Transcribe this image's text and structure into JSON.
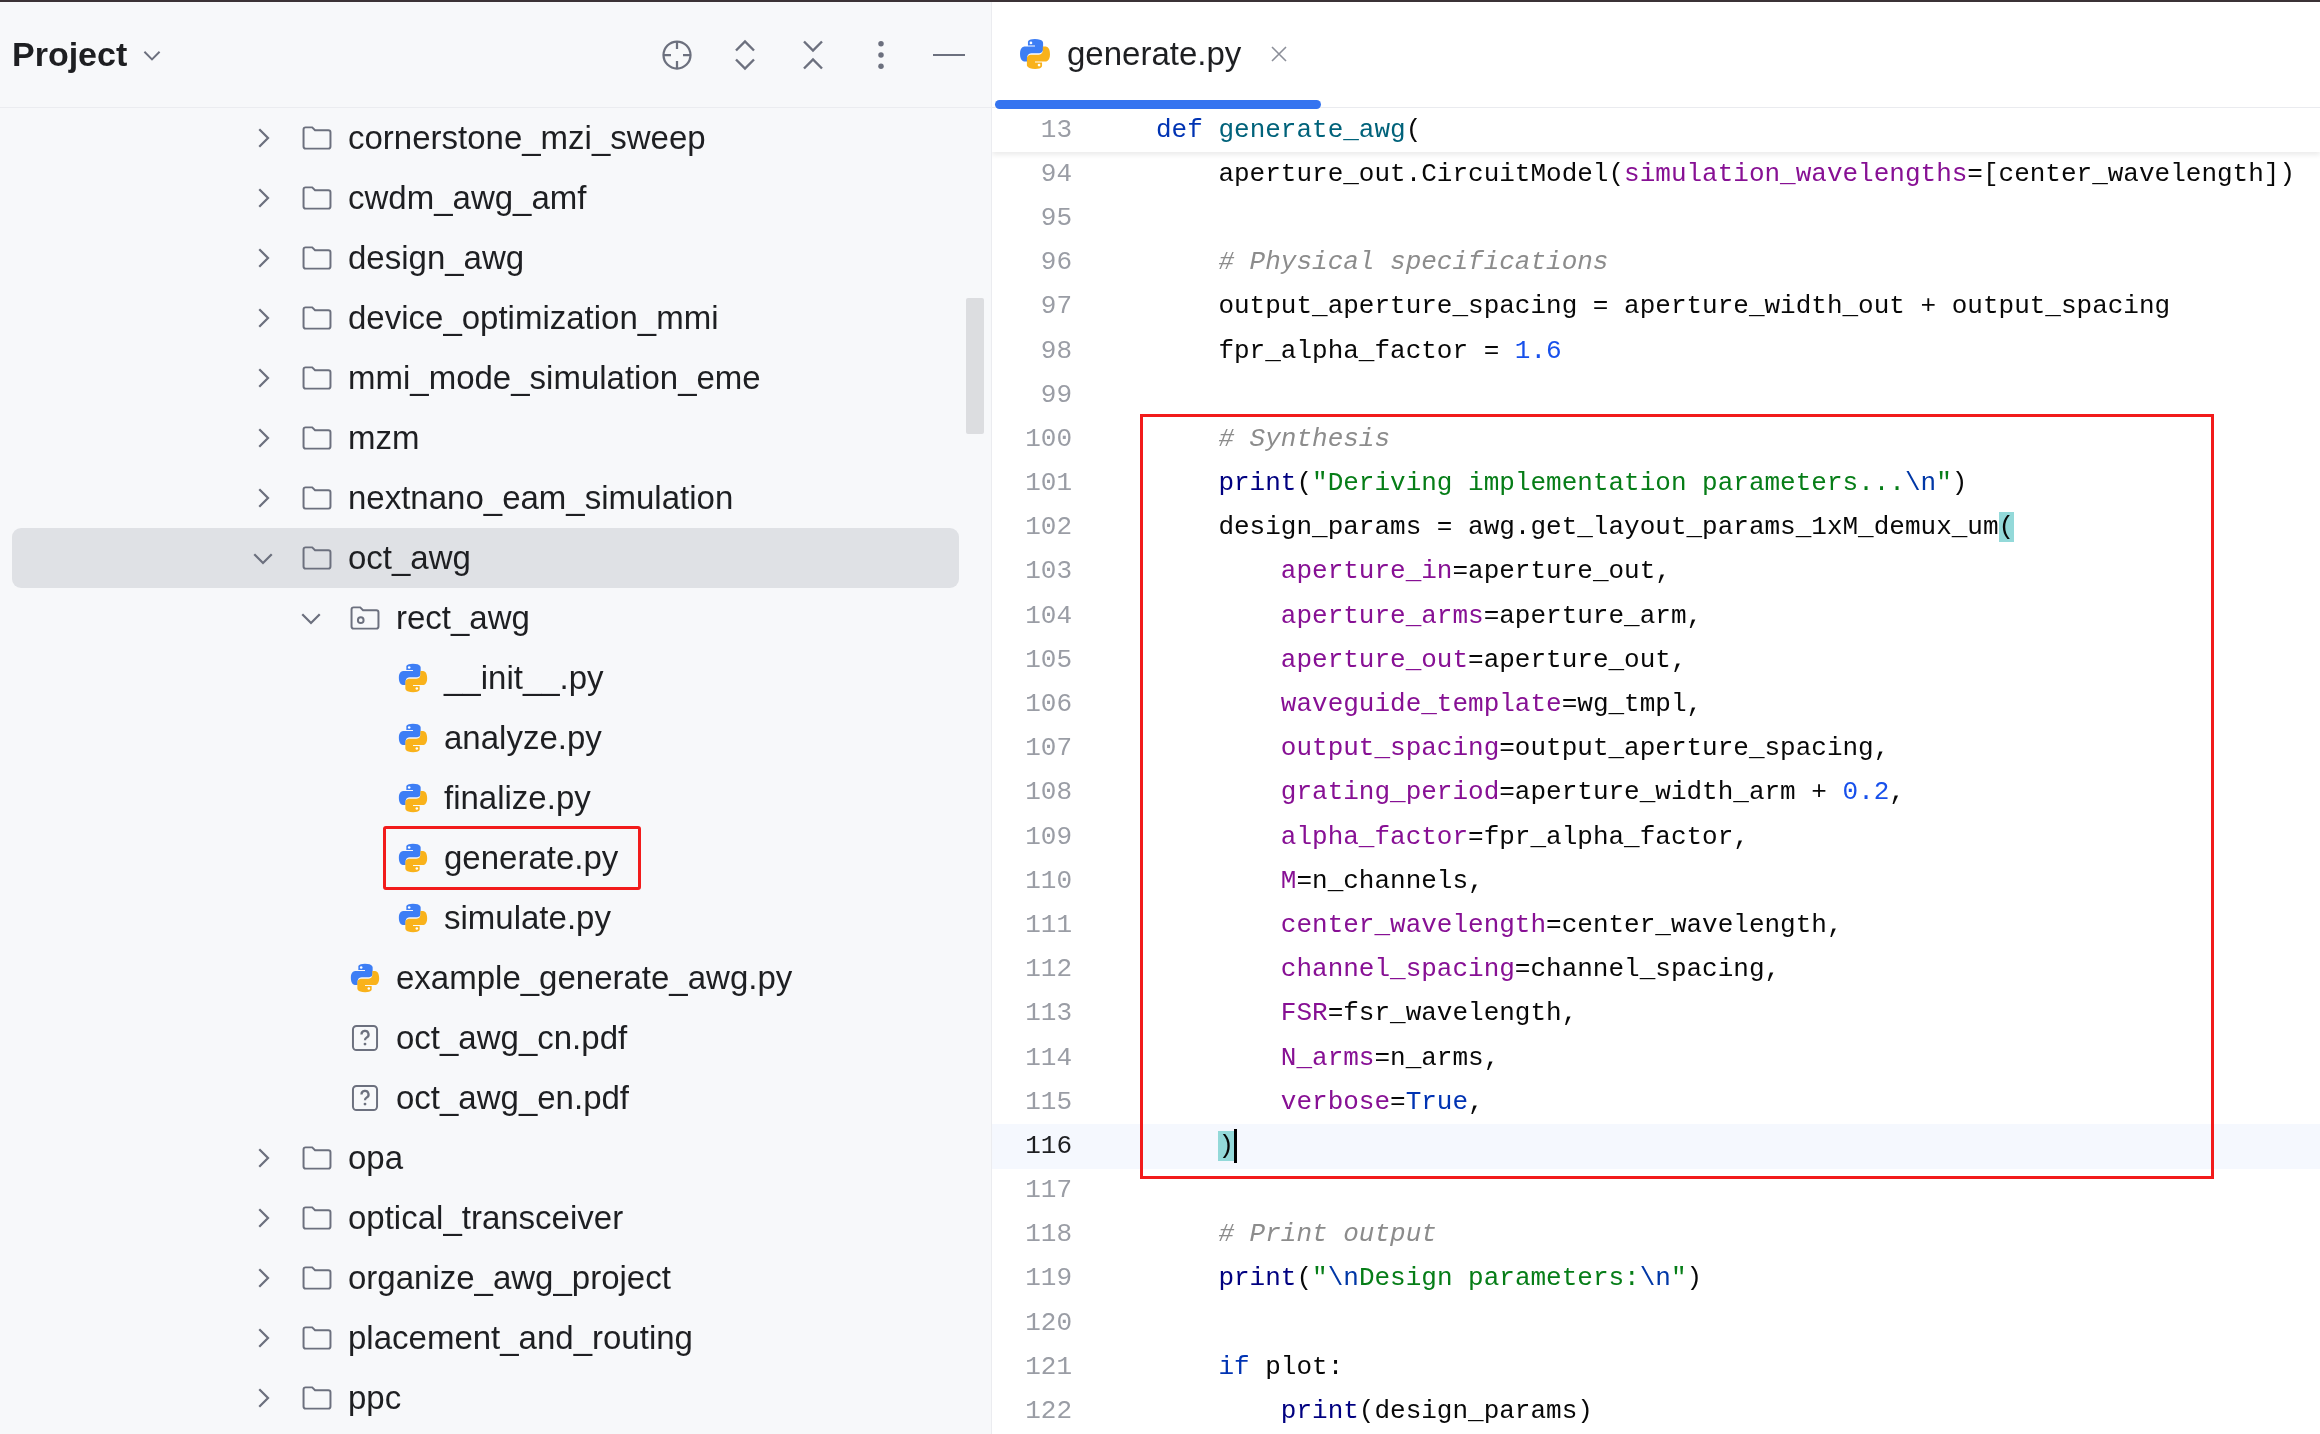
{
  "project_panel": {
    "title": "Project",
    "tree": [
      {
        "label": "cornerstone_mzi_sweep",
        "kind": "folder",
        "expanded": false,
        "selected": false,
        "highlighted": false
      },
      {
        "label": "cwdm_awg_amf",
        "kind": "folder",
        "expanded": false,
        "selected": false,
        "highlighted": false
      },
      {
        "label": "design_awg",
        "kind": "folder",
        "expanded": false,
        "selected": false,
        "highlighted": false
      },
      {
        "label": "device_optimization_mmi",
        "kind": "folder",
        "expanded": false,
        "selected": false,
        "highlighted": false
      },
      {
        "label": "mmi_mode_simulation_eme",
        "kind": "folder",
        "expanded": false,
        "selected": false,
        "highlighted": false
      },
      {
        "label": "mzm",
        "kind": "folder",
        "expanded": false,
        "selected": false,
        "highlighted": false
      },
      {
        "label": "nextnano_eam_simulation",
        "kind": "folder",
        "expanded": false,
        "selected": false,
        "highlighted": false
      },
      {
        "label": "oct_awg",
        "kind": "folder",
        "expanded": true,
        "selected": true,
        "highlighted": false,
        "children": [
          {
            "label": "rect_awg",
            "kind": "package",
            "expanded": true,
            "selected": false,
            "highlighted": false,
            "children": [
              {
                "label": "__init__.py",
                "kind": "python",
                "selected": false,
                "highlighted": false
              },
              {
                "label": "analyze.py",
                "kind": "python",
                "selected": false,
                "highlighted": false
              },
              {
                "label": "finalize.py",
                "kind": "python",
                "selected": false,
                "highlighted": false
              },
              {
                "label": "generate.py",
                "kind": "python",
                "selected": false,
                "highlighted": true
              },
              {
                "label": "simulate.py",
                "kind": "python",
                "selected": false,
                "highlighted": false
              }
            ]
          },
          {
            "label": "example_generate_awg.py",
            "kind": "python",
            "selected": false,
            "highlighted": false
          },
          {
            "label": "oct_awg_cn.pdf",
            "kind": "unknown",
            "selected": false,
            "highlighted": false
          },
          {
            "label": "oct_awg_en.pdf",
            "kind": "unknown",
            "selected": false,
            "highlighted": false
          }
        ]
      },
      {
        "label": "opa",
        "kind": "folder",
        "expanded": false,
        "selected": false,
        "highlighted": false
      },
      {
        "label": "optical_transceiver",
        "kind": "folder",
        "expanded": false,
        "selected": false,
        "highlighted": false
      },
      {
        "label": "organize_awg_project",
        "kind": "folder",
        "expanded": false,
        "selected": false,
        "highlighted": false
      },
      {
        "label": "placement_and_routing",
        "kind": "folder",
        "expanded": false,
        "selected": false,
        "highlighted": false
      },
      {
        "label": "ppc",
        "kind": "folder",
        "expanded": false,
        "selected": false,
        "highlighted": false
      }
    ]
  },
  "editor": {
    "tabs": [
      {
        "label": "generate.py",
        "selected": true
      }
    ],
    "sticky_line": {
      "number": "13",
      "tokens": [
        {
          "text": "def ",
          "kind": "kw"
        },
        {
          "text": "generate_awg",
          "kind": "fn"
        },
        {
          "text": "(",
          "kind": "plain"
        }
      ]
    },
    "blocks": [
      {
        "boxed": false,
        "lines": [
          {
            "number": "94",
            "current": false,
            "tokens": [
              {
                "text": "    aperture_out.CircuitModel(",
                "kind": "plain"
              },
              {
                "text": "simulation_wavelengths",
                "kind": "param"
              },
              {
                "text": "=[center_wavelength])",
                "kind": "plain"
              }
            ]
          },
          {
            "number": "95",
            "current": false
          },
          {
            "number": "96",
            "current": false,
            "tokens": [
              {
                "text": "    # Physical specifications",
                "kind": "comment"
              }
            ]
          },
          {
            "number": "97",
            "current": false,
            "tokens": [
              {
                "text": "    output_aperture_spacing = aperture_width_out + output_spacing",
                "kind": "plain"
              }
            ]
          },
          {
            "number": "98",
            "current": false,
            "tokens": [
              {
                "text": "    fpr_alpha_factor = ",
                "kind": "plain"
              },
              {
                "text": "1.6",
                "kind": "num"
              }
            ]
          },
          {
            "number": "99",
            "current": false
          }
        ]
      },
      {
        "boxed": true,
        "lines": [
          {
            "number": "100",
            "current": false,
            "tokens": [
              {
                "text": "    # Synthesis",
                "kind": "comment"
              }
            ]
          },
          {
            "number": "101",
            "current": false,
            "tokens": [
              {
                "text": "    print",
                "kind": "builtin"
              },
              {
                "text": "(",
                "kind": "plain"
              },
              {
                "text": "\"Deriving implementation parameters...",
                "kind": "str"
              },
              {
                "text": "\\n",
                "kind": "esc"
              },
              {
                "text": "\"",
                "kind": "str"
              },
              {
                "text": ")",
                "kind": "plain"
              }
            ]
          },
          {
            "number": "102",
            "current": false,
            "tokens": [
              {
                "text": "    design_params = awg.get_layout_params_1xM_demux_um",
                "kind": "plain"
              },
              {
                "text": "(",
                "kind": "match"
              }
            ]
          },
          {
            "number": "103",
            "current": false,
            "tokens": [
              {
                "text": "        aperture_in",
                "kind": "param"
              },
              {
                "text": "=aperture_out,",
                "kind": "plain"
              }
            ]
          },
          {
            "number": "104",
            "current": false,
            "tokens": [
              {
                "text": "        aperture_arms",
                "kind": "param"
              },
              {
                "text": "=aperture_arm,",
                "kind": "plain"
              }
            ]
          },
          {
            "number": "105",
            "current": false,
            "tokens": [
              {
                "text": "        aperture_out",
                "kind": "param"
              },
              {
                "text": "=aperture_out,",
                "kind": "plain"
              }
            ]
          },
          {
            "number": "106",
            "current": false,
            "tokens": [
              {
                "text": "        waveguide_template",
                "kind": "param"
              },
              {
                "text": "=wg_tmpl,",
                "kind": "plain"
              }
            ]
          },
          {
            "number": "107",
            "current": false,
            "tokens": [
              {
                "text": "        output_spacing",
                "kind": "param"
              },
              {
                "text": "=output_aperture_spacing,",
                "kind": "plain"
              }
            ]
          },
          {
            "number": "108",
            "current": false,
            "tokens": [
              {
                "text": "        grating_period",
                "kind": "param"
              },
              {
                "text": "=aperture_width_arm + ",
                "kind": "plain"
              },
              {
                "text": "0.2",
                "kind": "num"
              },
              {
                "text": ",",
                "kind": "plain"
              }
            ]
          },
          {
            "number": "109",
            "current": false,
            "tokens": [
              {
                "text": "        alpha_factor",
                "kind": "param"
              },
              {
                "text": "=fpr_alpha_factor,",
                "kind": "plain"
              }
            ]
          },
          {
            "number": "110",
            "current": false,
            "tokens": [
              {
                "text": "        M",
                "kind": "param"
              },
              {
                "text": "=n_channels,",
                "kind": "plain"
              }
            ]
          },
          {
            "number": "111",
            "current": false,
            "tokens": [
              {
                "text": "        center_wavelength",
                "kind": "param"
              },
              {
                "text": "=center_wavelength,",
                "kind": "plain"
              }
            ]
          },
          {
            "number": "112",
            "current": false,
            "tokens": [
              {
                "text": "        channel_spacing",
                "kind": "param"
              },
              {
                "text": "=channel_spacing,",
                "kind": "plain"
              }
            ]
          },
          {
            "number": "113",
            "current": false,
            "tokens": [
              {
                "text": "        FSR",
                "kind": "param"
              },
              {
                "text": "=fsr_wavelength,",
                "kind": "plain"
              }
            ]
          },
          {
            "number": "114",
            "current": false,
            "tokens": [
              {
                "text": "        N_arms",
                "kind": "param"
              },
              {
                "text": "=n_arms,",
                "kind": "plain"
              }
            ]
          },
          {
            "number": "115",
            "current": false,
            "tokens": [
              {
                "text": "        verbose",
                "kind": "param"
              },
              {
                "text": "=",
                "kind": "plain"
              },
              {
                "text": "True",
                "kind": "kw"
              },
              {
                "text": ",",
                "kind": "plain"
              }
            ]
          },
          {
            "number": "116",
            "current": true,
            "tokens": [
              {
                "text": "    )",
                "kind": "match"
              }
            ]
          }
        ]
      },
      {
        "boxed": false,
        "lines": [
          {
            "number": "117",
            "current": false
          },
          {
            "number": "118",
            "current": false,
            "tokens": [
              {
                "text": "    # Print output",
                "kind": "comment"
              }
            ]
          },
          {
            "number": "119",
            "current": false,
            "tokens": [
              {
                "text": "    print",
                "kind": "builtin"
              },
              {
                "text": "(",
                "kind": "plain"
              },
              {
                "text": "\"",
                "kind": "str"
              },
              {
                "text": "\\n",
                "kind": "esc"
              },
              {
                "text": "Design parameters:",
                "kind": "str"
              },
              {
                "text": "\\n",
                "kind": "esc"
              },
              {
                "text": "\"",
                "kind": "str"
              },
              {
                "text": ")",
                "kind": "plain"
              }
            ]
          },
          {
            "number": "120",
            "current": false
          },
          {
            "number": "121",
            "current": false,
            "tokens": [
              {
                "text": "    if",
                "kind": "kw"
              },
              {
                "text": " plot:",
                "kind": "plain"
              }
            ]
          },
          {
            "number": "122",
            "current": false,
            "tokens": [
              {
                "text": "        print",
                "kind": "builtin"
              },
              {
                "text": "(design_params)",
                "kind": "plain"
              }
            ]
          }
        ]
      }
    ]
  }
}
